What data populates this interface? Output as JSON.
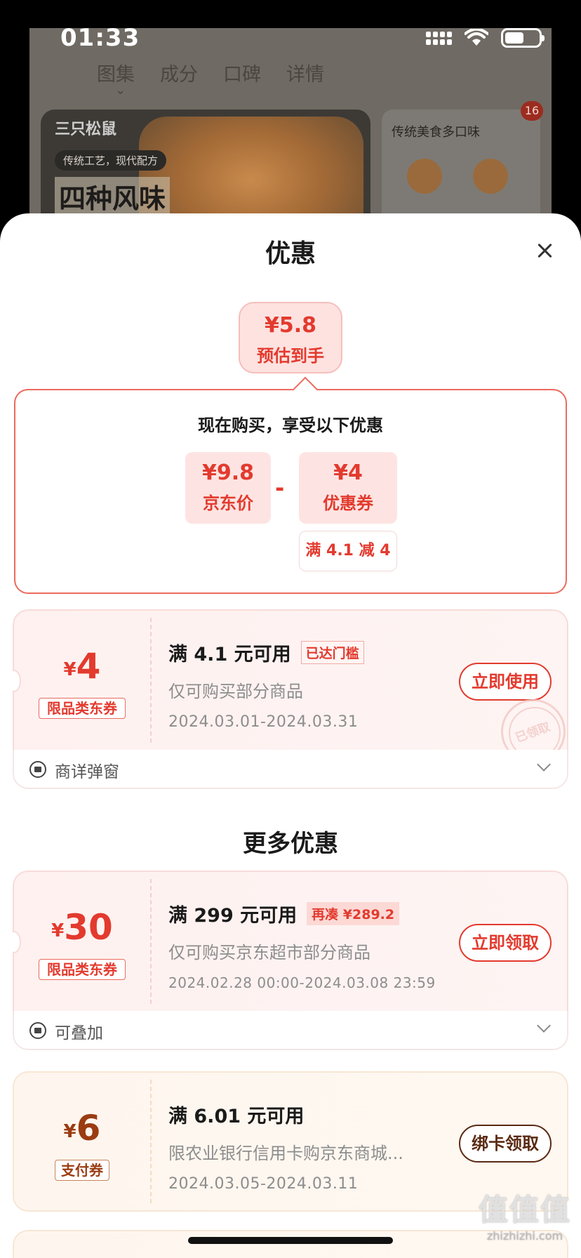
{
  "status": {
    "time": "01:33"
  },
  "background": {
    "tabs": [
      "图集",
      "成分",
      "口碑",
      "详情"
    ],
    "brand": "三只松鼠",
    "badge": "传统工艺，现代配方",
    "headline": "四种风味",
    "side_title": "传统美食多口味",
    "count": "16"
  },
  "sheet": {
    "title": "优惠",
    "estimate": {
      "price": "¥5.8",
      "label": "预估到手"
    },
    "calc": {
      "title": "现在购买，享受以下优惠",
      "price_value": "¥9.8",
      "price_label": "京东价",
      "minus": "-",
      "coupon_value": "¥4",
      "coupon_label": "优惠券",
      "coupon_condition": "满 4.1 减 4"
    },
    "coupons": [
      {
        "currency": "¥",
        "amount": "4",
        "tag": "限品类东券",
        "main": "满 4.1 元可用",
        "badge": "已达门槛",
        "sub": "仅可购买部分商品",
        "date": "2024.03.01-2024.03.31",
        "button": "立即使用",
        "stamp": "已领取",
        "footer": "商详弹窗"
      }
    ],
    "more_title": "更多优惠",
    "more_coupons": [
      {
        "currency": "¥",
        "amount": "30",
        "tag": "限品类东券",
        "main": "满 299 元可用",
        "badge": "再凑 ¥289.2",
        "sub": "仅可购买京东超市部分商品",
        "date": "2024.02.28 00:00-2024.03.08 23:59",
        "button": "立即领取",
        "footer": "可叠加"
      },
      {
        "currency": "¥",
        "amount": "6",
        "tag": "支付券",
        "main": "满 6.01 元可用",
        "sub": "限农业银行信用卡购京东商城...",
        "date": "2024.03.05-2024.03.11",
        "button": "绑卡领取"
      }
    ]
  },
  "watermark": {
    "line1": "值值值",
    "line2": "zhizhizhi.com"
  }
}
